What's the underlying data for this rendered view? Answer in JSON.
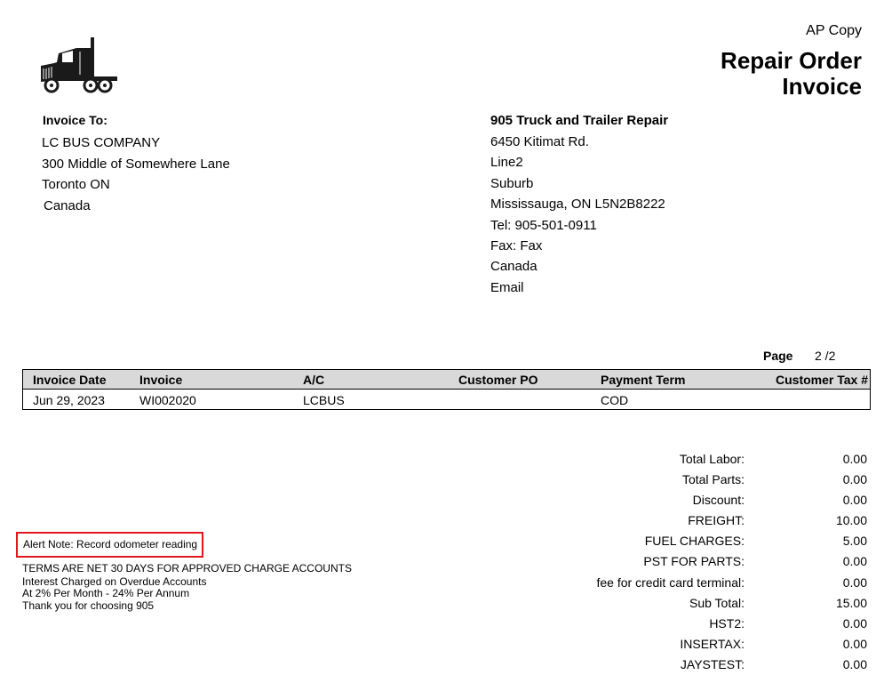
{
  "header": {
    "logo_icon": "semi-truck-icon",
    "copy_label": "AP Copy",
    "title_line1": "Repair Order",
    "title_line2": "Invoice"
  },
  "bill_to": {
    "heading": "Invoice To:",
    "lines": [
      "LC BUS COMPANY",
      "300 Middle of Somewhere Lane",
      "Toronto ON",
      "Canada"
    ]
  },
  "company": {
    "name": "905 Truck and Trailer Repair",
    "lines": [
      "6450 Kitimat Rd.",
      "Line2",
      "Suburb",
      "Mississauga, ON L5N2B8222",
      "Tel: 905-501-0911",
      "Fax: Fax",
      "Canada",
      "Email"
    ]
  },
  "page": {
    "label": "Page",
    "value": "2 /2"
  },
  "invoice_table": {
    "columns": [
      "Invoice Date",
      "Invoice",
      "A/C",
      "Customer PO",
      "Payment Term",
      "Customer Tax #"
    ],
    "row": [
      "Jun 29, 2023",
      "WI002020",
      "LCBUS",
      "",
      "COD",
      ""
    ]
  },
  "alert_note": "Alert Note: Record odometer reading",
  "terms": [
    "TERMS ARE NET 30 DAYS FOR APPROVED CHARGE ACCOUNTS",
    "Interest Charged on Overdue Accounts",
    "At 2% Per Month - 24% Per Annum",
    "Thank you for choosing 905"
  ],
  "totals": [
    {
      "label": "Total Labor:",
      "value": "0.00"
    },
    {
      "label": "Total Parts:",
      "value": "0.00"
    },
    {
      "label": "Discount:",
      "value": "0.00"
    },
    {
      "label": "FREIGHT:",
      "value": "10.00"
    },
    {
      "label": "FUEL CHARGES:",
      "value": "5.00"
    },
    {
      "label": "PST FOR PARTS:",
      "value": "0.00"
    },
    {
      "label": "fee for credit card terminal:",
      "value": "0.00"
    },
    {
      "label": "Sub Total:",
      "value": "15.00"
    },
    {
      "label": "HST2:",
      "value": "0.00"
    },
    {
      "label": "INSERTAX:",
      "value": "0.00"
    },
    {
      "label": "JAYSTEST:",
      "value": "0.00"
    }
  ],
  "colors": {
    "alert_border": "#e0181c",
    "table_header_bg": "#d9d9d9"
  }
}
